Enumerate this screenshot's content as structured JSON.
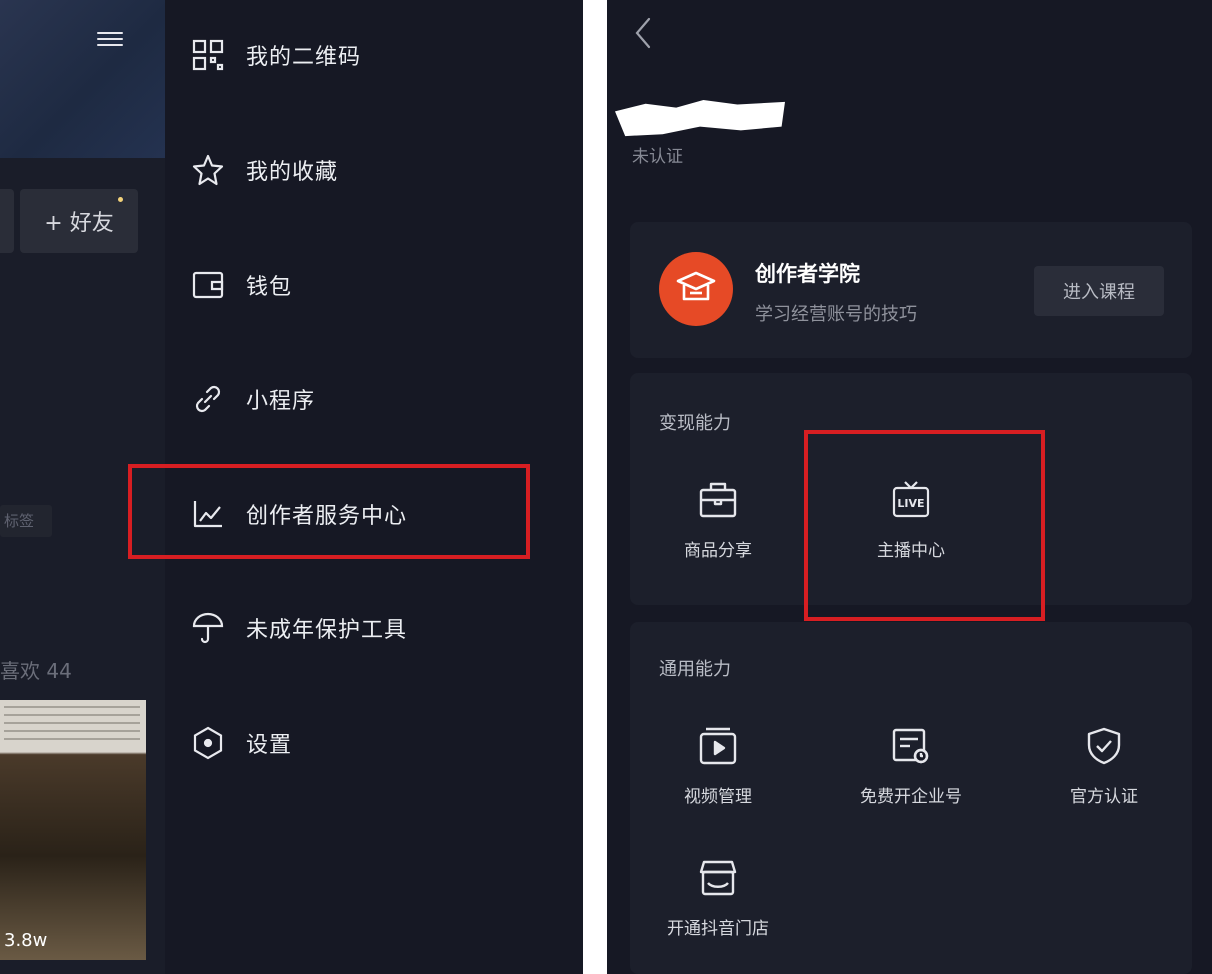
{
  "left_panel": {
    "friend_button_label": "+ 好友",
    "tag_text": "标签",
    "likes_text": "喜欢 44",
    "video_count": "3.8w",
    "menu": [
      {
        "label": "我的二维码",
        "icon": "qr-code-icon"
      },
      {
        "label": "我的收藏",
        "icon": "star-icon"
      },
      {
        "label": "钱包",
        "icon": "wallet-icon"
      },
      {
        "label": "小程序",
        "icon": "link-icon"
      },
      {
        "label": "创作者服务中心",
        "icon": "chart-icon"
      },
      {
        "label": "未成年保护工具",
        "icon": "umbrella-icon"
      },
      {
        "label": "设置",
        "icon": "settings-icon"
      }
    ],
    "highlight_color": "#d71e22"
  },
  "right_panel": {
    "status": "未认证",
    "academy": {
      "title": "创作者学院",
      "subtitle": "学习经营账号的技巧",
      "button": "进入课程",
      "logo_color": "#e64a26"
    },
    "monetization": {
      "title": "变现能力",
      "items": [
        {
          "label": "商品分享",
          "icon": "shopping-bag-icon"
        },
        {
          "label": "主播中心",
          "icon": "live-tv-icon"
        }
      ]
    },
    "general": {
      "title": "通用能力",
      "items": [
        {
          "label": "视频管理",
          "icon": "video-manage-icon"
        },
        {
          "label": "免费开企业号",
          "icon": "enterprise-account-icon"
        },
        {
          "label": "官方认证",
          "icon": "shield-check-icon"
        },
        {
          "label": "开通抖音门店",
          "icon": "store-icon"
        }
      ]
    }
  }
}
